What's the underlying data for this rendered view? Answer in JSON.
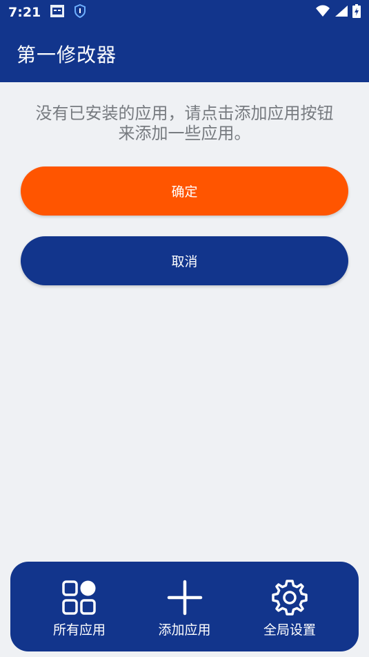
{
  "status_bar": {
    "time": "7:21",
    "icons_left": [
      "notification-app-icon",
      "shield-app-icon"
    ],
    "icons_right": [
      "wifi-icon",
      "signal-icon",
      "battery-charging-icon"
    ]
  },
  "app_bar": {
    "title": "第一修改器"
  },
  "main": {
    "empty_message_line1": "没有已安装的应用，请点击添加应用按钮",
    "empty_message_line2": "来添加一些应用。",
    "confirm_label": "确定",
    "cancel_label": "取消"
  },
  "bottom_nav": {
    "items": [
      {
        "label": "所有应用",
        "icon": "apps-grid-icon"
      },
      {
        "label": "添加应用",
        "icon": "plus-icon"
      },
      {
        "label": "全局设置",
        "icon": "gear-icon"
      }
    ]
  },
  "colors": {
    "primary": "#12358c",
    "accent": "#ff5500",
    "background": "#eff1f4",
    "muted_text": "#777b80"
  }
}
